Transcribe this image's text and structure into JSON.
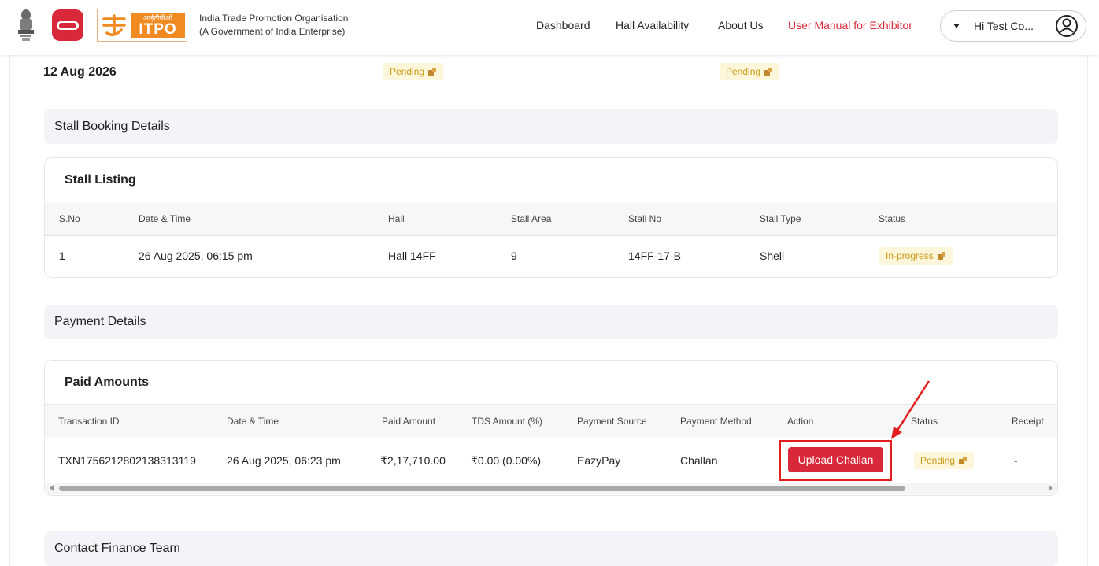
{
  "header": {
    "itpo_hindi": "आईटीपीओ",
    "itpo_text": "ITPO",
    "org_line1": "India Trade Promotion Organisation",
    "org_line2": "(A Government of India Enterprise)",
    "nav": [
      "Dashboard",
      "Hall Availability",
      "About Us",
      "User Manual for Exhibitor"
    ],
    "user_name": "Hi Test Co..."
  },
  "summary": {
    "date": "12 Aug 2026",
    "badge_1": "Pending",
    "badge_2": "Pending"
  },
  "stall_section": {
    "heading": "Stall Booking Details",
    "card_title": "Stall Listing",
    "columns": [
      "S.No",
      "Date & Time",
      "Hall",
      "Stall Area",
      "Stall No",
      "Stall Type",
      "Status"
    ],
    "rows": [
      {
        "sno": "1",
        "datetime": "26 Aug 2025, 06:15 pm",
        "hall": "Hall 14FF",
        "area": "9",
        "stall_no": "14FF-17-B",
        "type": "Shell",
        "status": "In-progress"
      }
    ]
  },
  "payment_section": {
    "heading": "Payment Details",
    "card_title": "Paid Amounts",
    "columns": [
      "Transaction ID",
      "Date & Time",
      "Paid Amount",
      "TDS Amount (%)",
      "Payment Source",
      "Payment Method",
      "Action",
      "Status",
      "Receipt"
    ],
    "rows": [
      {
        "txn": "TXN1756212802138313119",
        "datetime": "26 Aug 2025, 06:23 pm",
        "paid": "₹2,17,710.00",
        "tds": "₹0.00 (0.00%)",
        "source": "EazyPay",
        "method": "Challan",
        "action": "Upload Challan",
        "status": "Pending",
        "receipt": "-"
      }
    ]
  },
  "contact_section": {
    "heading": "Contact Finance Team"
  },
  "colors": {
    "brand_red": "#d8283a",
    "brand_orange": "#f28a22",
    "pending_bg": "#fdf6da",
    "pending_text": "#c99a14",
    "annotation_red": "#e21d1d"
  },
  "icons": [
    "national-emblem-icon",
    "brand-logo-icon",
    "itpo-logo-icon",
    "caret-down-icon",
    "user-circle-icon",
    "money-bag-icon",
    "red-arrow-annotation"
  ]
}
